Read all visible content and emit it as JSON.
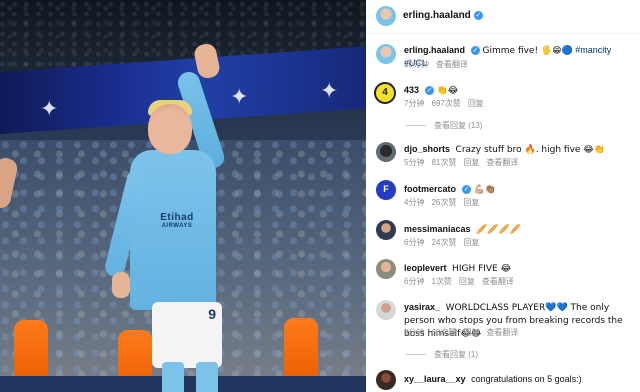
{
  "photo": {
    "shirt_sponsor": "Etihad",
    "shirt_subtext": "AIRWAYS",
    "shorts_number": "9"
  },
  "header": {
    "username": "erling.haaland",
    "verified": true
  },
  "caption": {
    "username": "erling.haaland",
    "text": "Gimme five! 🖐😁🔵",
    "hashtags": "#mancity #UCL",
    "time": "10分钟",
    "translate": "查看翻译"
  },
  "comments": [
    {
      "username": "433",
      "text": "👏😂",
      "time": "7分钟",
      "likes": "697次赞",
      "reply": "回复",
      "view_replies": "查看回复 (13)"
    },
    {
      "username": "djo_shorts",
      "text": "Crazy stuff bro 🔥. high five 😂👏",
      "time": "5分钟",
      "likes": "81次赞",
      "reply": "回复",
      "translate": "查看翻译"
    },
    {
      "username": "footmercato",
      "text": "💪🏼👏🏽",
      "time": "4分钟",
      "likes": "26次赞",
      "reply": "回复"
    },
    {
      "username": "messimaniacas",
      "text": "🥖🥖🥖🥖",
      "time": "6分钟",
      "likes": "24次赞",
      "reply": "回复"
    },
    {
      "username": "leoplevert",
      "text": "HIGH FIVE 😂",
      "time": "6分钟",
      "likes": "1次赞",
      "reply": "回复",
      "translate": "查看翻译"
    },
    {
      "username": "yasirax_",
      "text": "WORLDCLASS PLAYER💙💙 The only person who stops you from breaking records the boss himself😂😂",
      "time": "8分钟",
      "likes": "68次赞",
      "reply": "回复",
      "translate": "查看翻译",
      "view_replies": "查看回复 (1)"
    },
    {
      "username": "xy__laura__xy",
      "text": "congratulations on 5 goals:)"
    }
  ],
  "colors": {
    "verified": "#3897f0",
    "meta_gray": "#8e8e8e",
    "hashtag": "#00376b"
  }
}
